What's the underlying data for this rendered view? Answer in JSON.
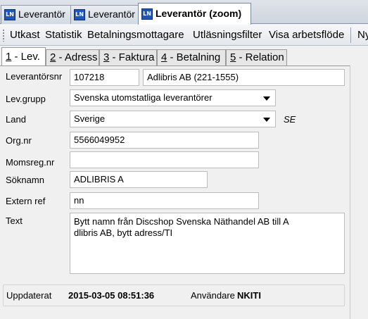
{
  "doc_tabs": [
    {
      "label": "Leverantör",
      "icon": "app-icon"
    },
    {
      "label": "Leverantör",
      "icon": "app-icon"
    },
    {
      "label": "Leverantör (zoom)",
      "icon": "app-icon"
    }
  ],
  "app_icon_text": "LN",
  "toolbar": [
    "Utkast",
    "Statistik",
    "Betalningsmottagare",
    "Utläsningsfilter",
    "Visa arbetsflöde",
    "Ny"
  ],
  "inner_tabs": [
    {
      "key": "1",
      "label": " - Lev."
    },
    {
      "key": "2",
      "label": " - Adress"
    },
    {
      "key": "3",
      "label": " - Faktura"
    },
    {
      "key": "4",
      "label": " - Betalning"
    },
    {
      "key": "5",
      "label": " - Relation"
    }
  ],
  "form": {
    "leverantorsnr": {
      "label": "Leverantörsnr",
      "value": "107218",
      "name": "Adlibris AB (221-1555)"
    },
    "levgrupp": {
      "label": "Lev.grupp",
      "value": "Svenska utomstatliga leverantörer"
    },
    "land": {
      "label": "Land",
      "value": "Sverige",
      "code": "SE"
    },
    "orgnr": {
      "label": "Org.nr",
      "value": "5566049952"
    },
    "momsregnr": {
      "label": "Momsreg.nr",
      "value": ""
    },
    "soknamn": {
      "label": "Söknamn",
      "value": "ADLIBRIS A"
    },
    "externref": {
      "label": "Extern ref",
      "value": "nn"
    },
    "text": {
      "label": "Text",
      "value": "Bytt namn från Discshop Svenska Näthandel AB till A\ndlibris AB, bytt adress/TI"
    }
  },
  "footer": {
    "updated_label": "Uppdaterat",
    "updated_value": "2015-03-05 08:51:36",
    "user_label": "Användare",
    "user_value": "NKITI"
  },
  "colors": {
    "icon_blue": "#1f56b8",
    "tab_active": "#ffffff",
    "panel_bg": "#f0f0f0"
  }
}
